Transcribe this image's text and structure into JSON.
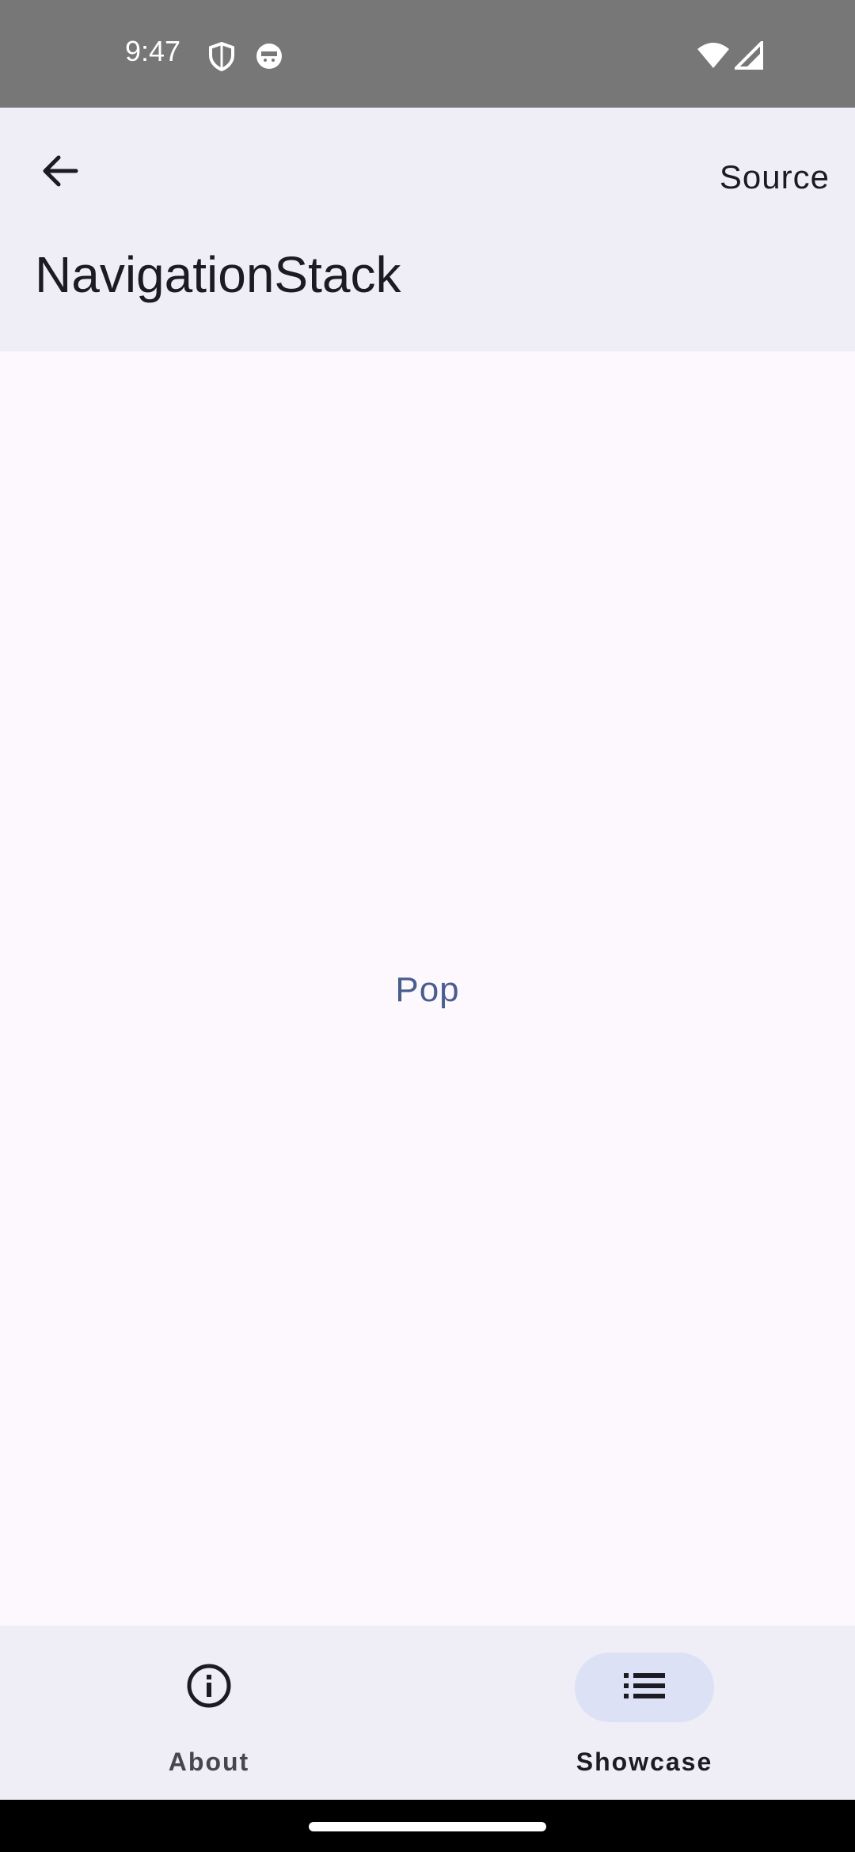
{
  "status_bar": {
    "time": "9:47",
    "icons": [
      "shield-icon",
      "face-icon",
      "wifi-icon",
      "signal-icon"
    ],
    "background": "#777777"
  },
  "app_bar": {
    "back_icon": "arrow-back-icon",
    "source_label": "Source",
    "title": "NavigationStack",
    "background": "#efedf6"
  },
  "main": {
    "pop_label": "Pop",
    "accent": "#4a5d8f"
  },
  "bottom_nav": {
    "items": [
      {
        "label": "About",
        "icon": "info-icon",
        "selected": false
      },
      {
        "label": "Showcase",
        "icon": "list-icon",
        "selected": true
      }
    ],
    "selected_pill_color": "#dde1f6"
  }
}
